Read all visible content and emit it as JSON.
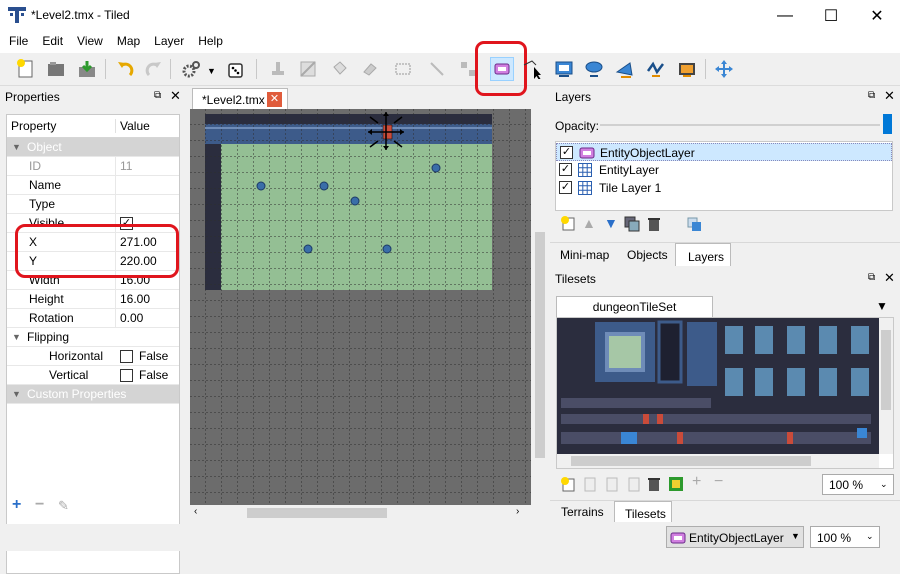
{
  "window": {
    "title": "*Level2.tmx - Tiled",
    "minimize": "—",
    "maximize": "☐",
    "close": "✕"
  },
  "menu": [
    "File",
    "Edit",
    "View",
    "Map",
    "Layer",
    "Help"
  ],
  "properties_panel": {
    "title": "Properties",
    "col_property": "Property",
    "col_value": "Value",
    "section_object": "Object",
    "rows": [
      {
        "name": "ID",
        "value": "11"
      },
      {
        "name": "Name",
        "value": ""
      },
      {
        "name": "Type",
        "value": ""
      },
      {
        "name": "Visible",
        "value": "✓"
      },
      {
        "name": "X",
        "value": "271.00"
      },
      {
        "name": "Y",
        "value": "220.00"
      },
      {
        "name": "Width",
        "value": "16.00"
      },
      {
        "name": "Height",
        "value": "16.00"
      },
      {
        "name": "Rotation",
        "value": "0.00"
      }
    ],
    "section_flipping": "Flipping",
    "flip_rows": [
      {
        "name": "Horizontal",
        "value": "False"
      },
      {
        "name": "Vertical",
        "value": "False"
      }
    ],
    "section_custom": "Custom Properties"
  },
  "editor": {
    "tab_label": "*Level2.tmx"
  },
  "layers_panel": {
    "title": "Layers",
    "opacity_label": "Opacity:",
    "layers": [
      {
        "name": "EntityObjectLayer",
        "checked": true,
        "selected": true
      },
      {
        "name": "EntityLayer",
        "checked": true,
        "selected": false
      },
      {
        "name": "Tile Layer 1",
        "checked": true,
        "selected": false
      }
    ],
    "tabs": [
      "Mini-map",
      "Objects",
      "Layers"
    ],
    "active_tab": "Layers"
  },
  "tilesets_panel": {
    "title": "Tilesets",
    "tileset_tab": "dungeonTileSet",
    "zoom": "100 %",
    "tabs": [
      "Terrains",
      "Tilesets"
    ],
    "active_tab": "Tilesets"
  },
  "statusbar": {
    "layer": "EntityObjectLayer",
    "zoom": "100 %"
  },
  "colors": {
    "highlight": "#e0151d",
    "selection": "#cde8ff"
  }
}
